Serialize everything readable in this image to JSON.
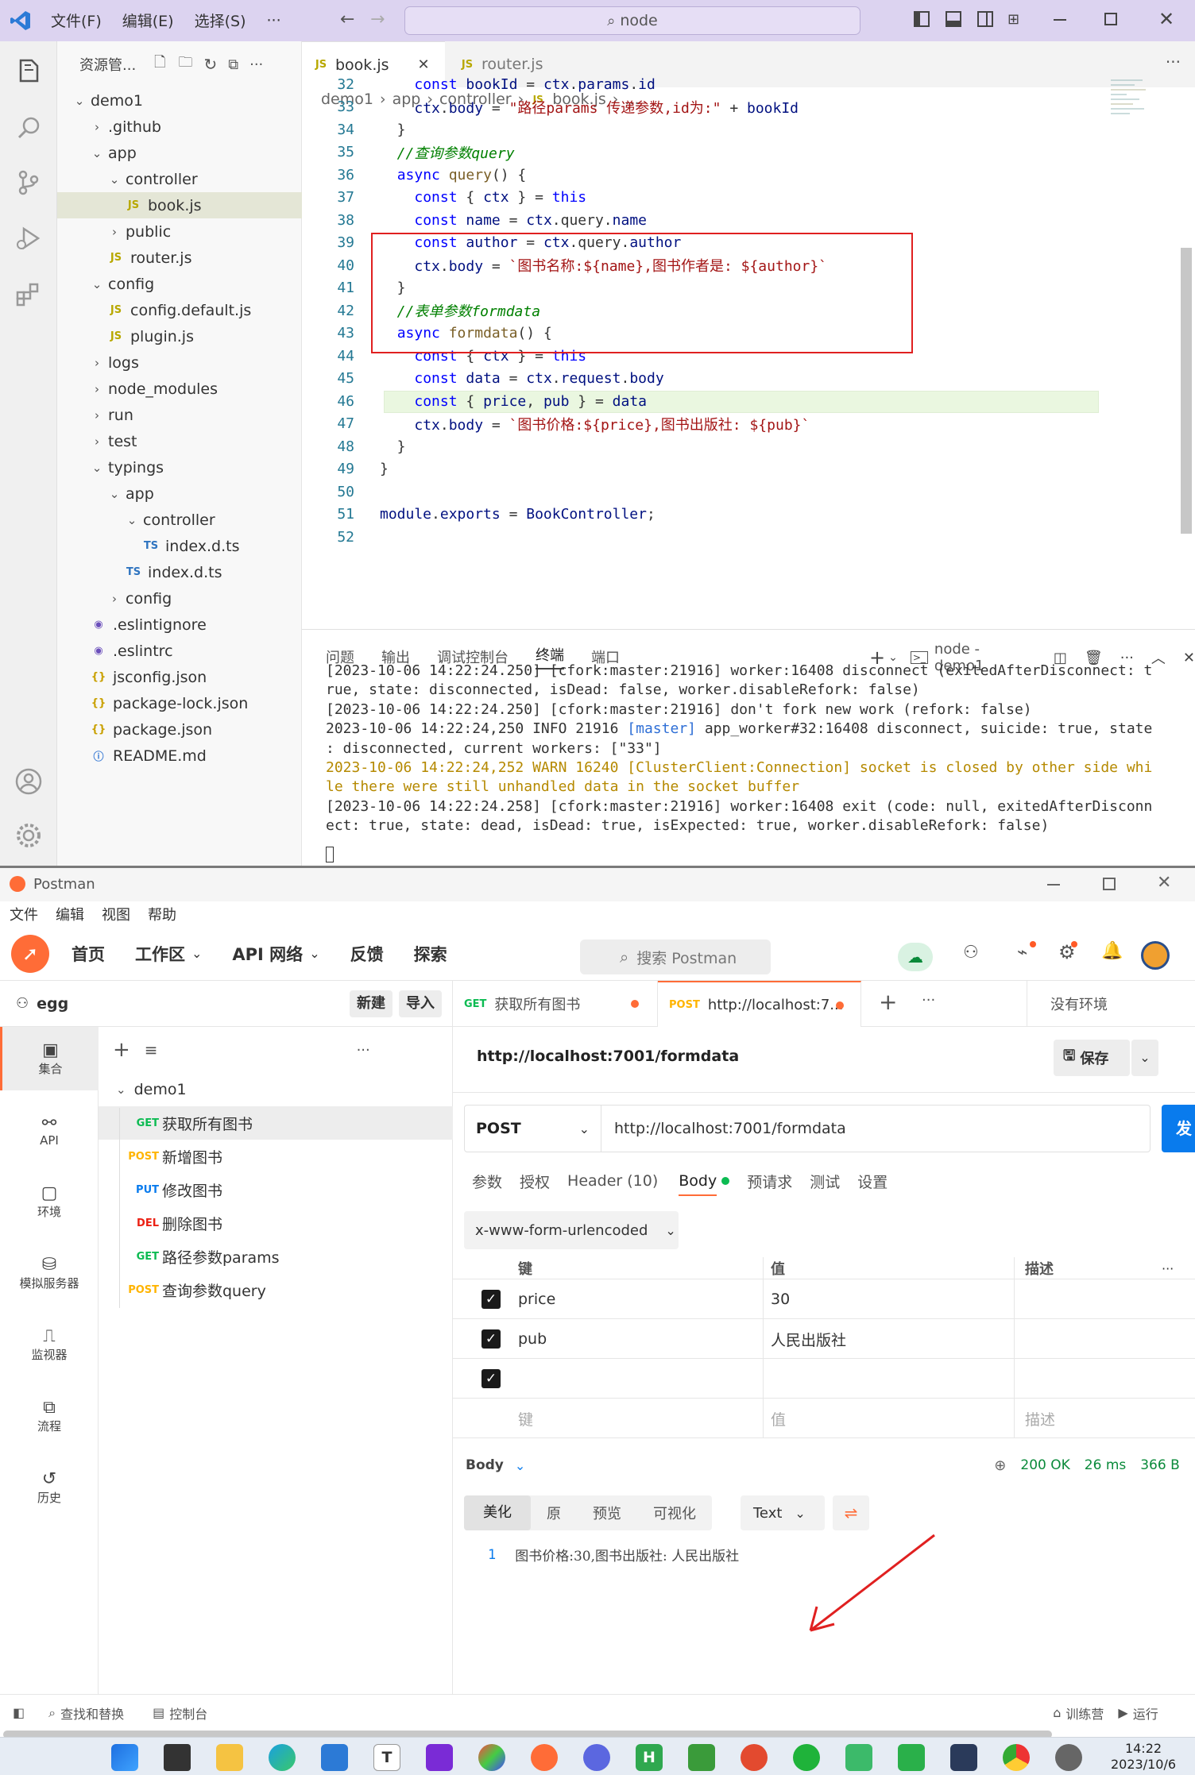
{
  "vscode": {
    "menu": [
      "文件(F)",
      "编辑(E)",
      "选择(S)",
      "···"
    ],
    "command_center": "node",
    "explorer": {
      "title": "资源管...",
      "tree": [
        {
          "label": "demo1",
          "depth": 0,
          "type": "folder-open"
        },
        {
          "label": ".github",
          "depth": 1,
          "type": "folder"
        },
        {
          "label": "app",
          "depth": 1,
          "type": "folder-open"
        },
        {
          "label": "controller",
          "depth": 2,
          "type": "folder-open"
        },
        {
          "label": "book.js",
          "depth": 3,
          "type": "js",
          "selected": true
        },
        {
          "label": "public",
          "depth": 2,
          "type": "folder"
        },
        {
          "label": "router.js",
          "depth": 2,
          "type": "js"
        },
        {
          "label": "config",
          "depth": 1,
          "type": "folder-open"
        },
        {
          "label": "config.default.js",
          "depth": 2,
          "type": "js"
        },
        {
          "label": "plugin.js",
          "depth": 2,
          "type": "js"
        },
        {
          "label": "logs",
          "depth": 1,
          "type": "folder"
        },
        {
          "label": "node_modules",
          "depth": 1,
          "type": "folder"
        },
        {
          "label": "run",
          "depth": 1,
          "type": "folder"
        },
        {
          "label": "test",
          "depth": 1,
          "type": "folder"
        },
        {
          "label": "typings",
          "depth": 1,
          "type": "folder-open"
        },
        {
          "label": "app",
          "depth": 2,
          "type": "folder-open"
        },
        {
          "label": "controller",
          "depth": 3,
          "type": "folder-open"
        },
        {
          "label": "index.d.ts",
          "depth": 4,
          "type": "ts"
        },
        {
          "label": "index.d.ts",
          "depth": 3,
          "type": "ts"
        },
        {
          "label": "config",
          "depth": 2,
          "type": "folder"
        },
        {
          "label": ".eslintignore",
          "depth": 1,
          "type": "eslint"
        },
        {
          "label": ".eslintrc",
          "depth": 1,
          "type": "eslint"
        },
        {
          "label": "jsconfig.json",
          "depth": 1,
          "type": "json"
        },
        {
          "label": "package-lock.json",
          "depth": 1,
          "type": "json"
        },
        {
          "label": "package.json",
          "depth": 1,
          "type": "json"
        },
        {
          "label": "README.md",
          "depth": 1,
          "type": "md"
        }
      ]
    },
    "tabs": [
      {
        "label": "book.js",
        "active": true
      },
      {
        "label": "router.js",
        "active": false
      }
    ],
    "breadcrumb": [
      "demo1",
      "app",
      "controller",
      "book.js",
      "..."
    ],
    "code": [
      {
        "n": "32",
        "t": "    const bookId = ctx.params.id"
      },
      {
        "n": "33",
        "t": "    ctx.body = \"路径params 传递参数,id为:\" + bookId"
      },
      {
        "n": "34",
        "t": "  }"
      },
      {
        "n": "35",
        "t": "  //查询参数query"
      },
      {
        "n": "36",
        "t": "  async query() {"
      },
      {
        "n": "37",
        "t": "    const { ctx } = this"
      },
      {
        "n": "38",
        "t": "    const name = ctx.query.name"
      },
      {
        "n": "39",
        "t": "    const author = ctx.query.author"
      },
      {
        "n": "40",
        "t": "    ctx.body = `图书名称:${name},图书作者是: ${author}`"
      },
      {
        "n": "41",
        "t": "  }"
      },
      {
        "n": "42",
        "t": "  //表单参数formdata"
      },
      {
        "n": "43",
        "t": "  async formdata() {"
      },
      {
        "n": "44",
        "t": "    const { ctx } = this"
      },
      {
        "n": "45",
        "t": "    const data = ctx.request.body"
      },
      {
        "n": "46",
        "t": "    const { price, pub } = data"
      },
      {
        "n": "47",
        "t": "    ctx.body = `图书价格:${price},图书出版社: ${pub}`"
      },
      {
        "n": "48",
        "t": "  }"
      },
      {
        "n": "49",
        "t": "}"
      },
      {
        "n": "50",
        "t": ""
      },
      {
        "n": "51",
        "t": "module.exports = BookController;"
      },
      {
        "n": "52",
        "t": ""
      }
    ],
    "panel_tabs": [
      "问题",
      "输出",
      "调试控制台",
      "终端",
      "端口"
    ],
    "panel_active": "终端",
    "terminal_name": "node - demo1",
    "terminal": [
      "[2023-10-06 14:22:24.250] [cfork:master:21916] worker:16408 disconnect (exitedAfterDisconnect: t",
      "rue, state: disconnected, isDead: false, worker.disableRefork: false)",
      "[2023-10-06 14:22:24.250] [cfork:master:21916] don't fork new work (refork: false)",
      "2023-10-06 14:22:24,250 INFO 21916 [master] app_worker#32:16408 disconnect, suicide: true, state",
      ": disconnected, current workers: [\"33\"]",
      "2023-10-06 14:22:24,252 WARN 16240 [ClusterClient:Connection] socket is closed by other side whi",
      "le there were still unhandled data in the socket buffer",
      "[2023-10-06 14:22:24.258] [cfork:master:21916] worker:16408 exit (code: null, exitedAfterDisconn",
      "ect: true, state: dead, isDead: true, isExpected: true, worker.disableRefork: false)"
    ]
  },
  "postman": {
    "title": "Postman",
    "menu": [
      "文件",
      "编辑",
      "视图",
      "帮助"
    ],
    "nav": [
      "首页",
      "工作区",
      "API 网络",
      "反馈",
      "探索"
    ],
    "search_placeholder": "搜索 Postman",
    "workspace": "egg",
    "new_btn": "新建",
    "import_btn": "导入",
    "rail": [
      "集合",
      "API",
      "环境",
      "模拟服务器",
      "监视器",
      "流程",
      "历史"
    ],
    "collection": "demo1",
    "requests": [
      {
        "method": "GET",
        "name": "获取所有图书"
      },
      {
        "method": "POST",
        "name": "新增图书"
      },
      {
        "method": "PUT",
        "name": "修改图书"
      },
      {
        "method": "DEL",
        "name": "删除图书"
      },
      {
        "method": "GET",
        "name": "路径参数params"
      },
      {
        "method": "POST",
        "name": "查询参数query"
      }
    ],
    "open_tabs": [
      {
        "method": "GET",
        "label": "获取所有图书"
      },
      {
        "method": "POST",
        "label": "http://localhost:7..."
      }
    ],
    "env": "没有环境",
    "request_title": "http://localhost:7001/formdata",
    "save": "保存",
    "method": "POST",
    "url": "http://localhost:7001/formdata",
    "req_tabs": [
      "参数",
      "授权",
      "Header (10)",
      "Body",
      "预请求",
      "测试",
      "设置"
    ],
    "body_type": "x-www-form-urlencoded",
    "kv_headers": {
      "key": "键",
      "value": "值",
      "desc": "描述"
    },
    "kv_rows": [
      {
        "key": "price",
        "value": "30"
      },
      {
        "key": "pub",
        "value": "人民出版社"
      },
      {
        "key": "",
        "value": ""
      }
    ],
    "kv_placeholder": {
      "key": "键",
      "value": "值",
      "desc": "描述"
    },
    "response": {
      "label": "Body",
      "status": "200 OK",
      "time": "26 ms",
      "size": "366 B",
      "view_tabs": [
        "美化",
        "原",
        "预览",
        "可视化"
      ],
      "format": "Text",
      "line_no": "1",
      "body": "图书价格:30,图书出版社: 人民出版社"
    },
    "footer": [
      "查找和替换",
      "控制台"
    ],
    "footer_right": [
      "训练营",
      "运行"
    ]
  },
  "taskbar": {
    "time": "14:22",
    "date": "2023/10/6"
  },
  "colors": {
    "vscode_title": "#dcd3f0",
    "postman_orange": "#ff6c37",
    "annotation_red": "#e02020",
    "send_blue": "#097bed"
  }
}
